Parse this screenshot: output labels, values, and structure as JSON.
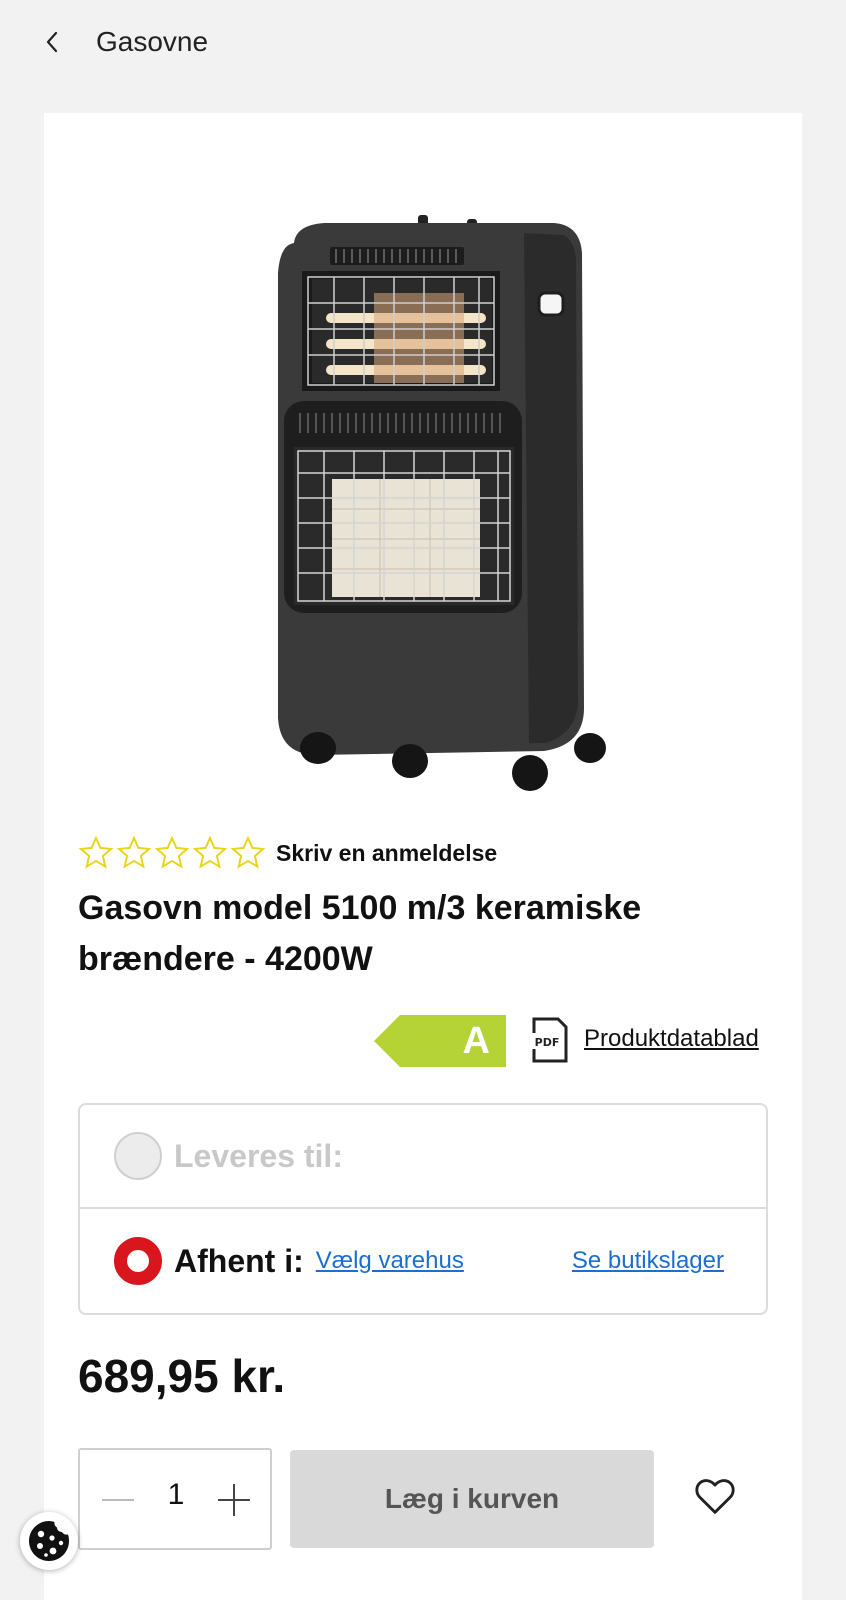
{
  "header": {
    "back_icon": "chevron-left-icon",
    "title": "Gasovne"
  },
  "product": {
    "rating": {
      "value": 0,
      "max": 5,
      "review_link": "Skriv en anmeldelse"
    },
    "title": "Gasovn model 5100 m/3 keramiske brændere - 4200W",
    "energy_class": "A",
    "energy_color": "#b5d334",
    "pdf_icon_label": "PDF",
    "datasheet_link": "Produktdatablad",
    "price": "689,95 kr."
  },
  "delivery": {
    "deliver_label": "Leveres til:",
    "pickup_label": "Afhent i:",
    "choose_store_link": "Vælg varehus",
    "store_stock_link": "Se butikslager",
    "accent_color": "#d9151e",
    "link_color": "#1a6fd1"
  },
  "cart": {
    "quantity": "1",
    "add_to_cart_label": "Læg i kurven"
  },
  "icons": {
    "wishlist": "heart-icon",
    "cookie": "cookie-icon"
  }
}
